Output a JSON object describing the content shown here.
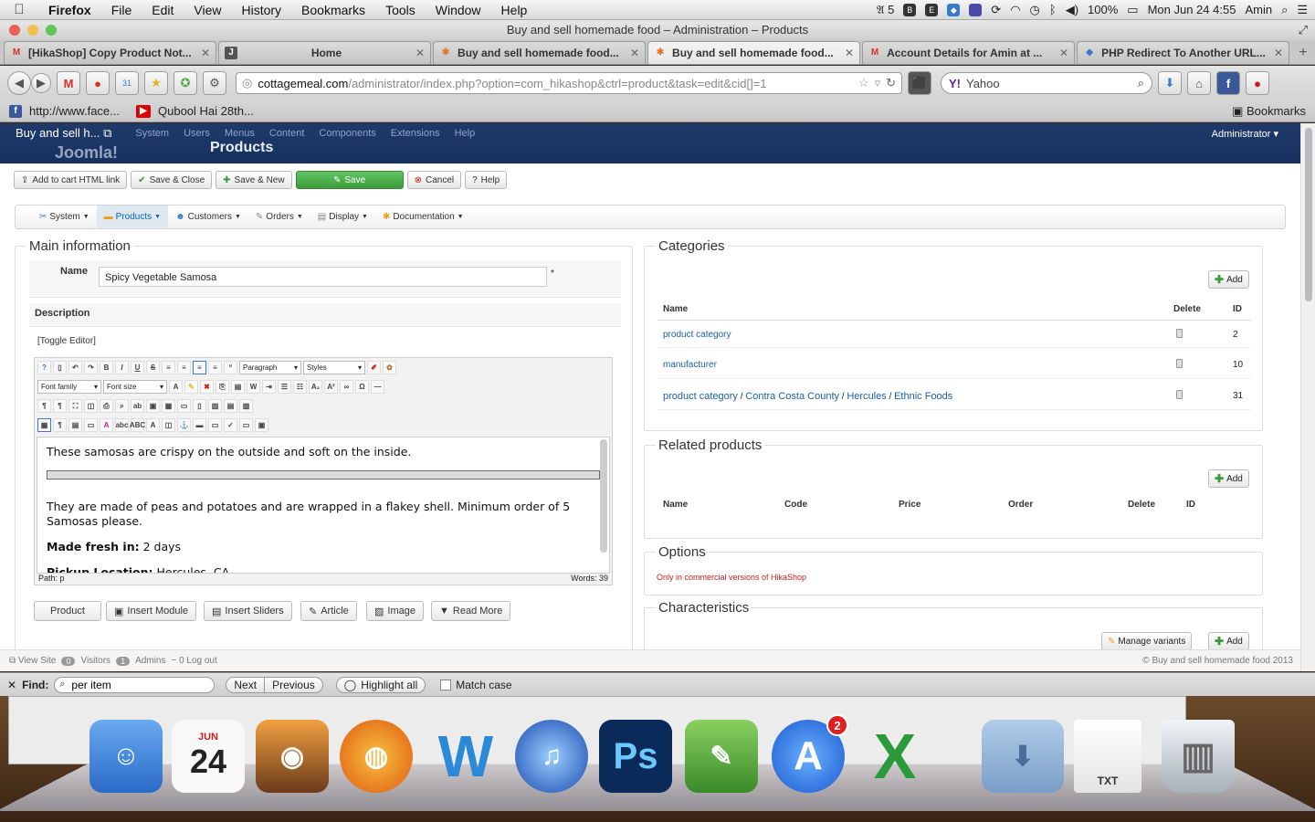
{
  "menubar": {
    "app": "Firefox",
    "items": [
      "File",
      "Edit",
      "View",
      "History",
      "Bookmarks",
      "Tools",
      "Window",
      "Help"
    ],
    "battery": "100%",
    "datetime": "Mon Jun 24  4:55",
    "user": "Amin",
    "badge": "5"
  },
  "window": {
    "title": "Buy and sell homemade food – Administration – Products"
  },
  "tabs": [
    {
      "title": "[HikaShop] Copy Product Not...",
      "icon": "gmail-icon",
      "color": "#d93025",
      "glyph": "M"
    },
    {
      "title": "",
      "icon": "joomla-icon",
      "color": "#555",
      "glyph": "J"
    },
    {
      "title": "Home",
      "icon": "",
      "color": "",
      "glyph": ""
    },
    {
      "title": "Buy and sell homemade food...",
      "icon": "joomla-icon",
      "color": "#e8742a",
      "glyph": "✱"
    },
    {
      "title": "Buy and sell homemade food...",
      "icon": "joomla-icon",
      "color": "#e8742a",
      "glyph": "✱"
    },
    {
      "title": "Account Details for Amin at ...",
      "icon": "gmail-icon",
      "color": "#d93025",
      "glyph": "M"
    },
    {
      "title": "PHP Redirect To Another URL...",
      "icon": "web-icon",
      "color": "#3a7ac8",
      "glyph": "◆"
    }
  ],
  "url": {
    "host": "cottagemeal.com",
    "path": "/administrator/index.php?option=com_hikashop&ctrl=product&task=edit&cid[]=1"
  },
  "search": {
    "engine": "Yahoo"
  },
  "bookmarks": {
    "items": [
      "http://www.face...",
      "Qubool Hai 28th..."
    ],
    "right": "Bookmarks"
  },
  "joomla": {
    "site": "Buy and sell h...",
    "nav": [
      "System",
      "Users",
      "Menus",
      "Content",
      "Components",
      "Extensions",
      "Help"
    ],
    "admin": "Administrator",
    "logo": "Joomla!",
    "page_title": "Products"
  },
  "toolbar": {
    "add_cart": "Add to cart HTML link",
    "save_close": "Save & Close",
    "save_new": "Save & New",
    "save": "Save",
    "cancel": "Cancel",
    "help": "Help"
  },
  "hikamenu": [
    "System",
    "Products",
    "Customers",
    "Orders",
    "Display",
    "Documentation"
  ],
  "main": {
    "legend": "Main information",
    "name_label": "Name",
    "name_value": "Spicy Vegetable Samosa",
    "required": "*",
    "desc_label": "Description",
    "toggle": "[Toggle Editor]"
  },
  "editor": {
    "para_select": "Paragraph",
    "styles_select": "Styles",
    "font_family": "Font family",
    "font_size": "Font size",
    "text1": "These samosas are crispy on the outside and soft on the inside.",
    "text2": "They are made of peas and potatoes and are wrapped in a flakey shell. Minimum order of 5 Samosas please.",
    "made_label": "Made fresh in:",
    "made_value": " 2 days",
    "pickup_label": "Pickup Location:",
    "pickup_value": " Hercules, CA",
    "path": "Path:  p",
    "words": "Words: 39"
  },
  "editor_buttons": [
    "Product",
    "Insert Module",
    "Insert Sliders",
    "Article",
    "Image",
    "Read More"
  ],
  "categories": {
    "legend": "Categories",
    "add": "Add",
    "headers": [
      "Name",
      "Delete",
      "ID"
    ],
    "rows": [
      {
        "path": [
          "product category"
        ],
        "id": "2"
      },
      {
        "path": [
          "manufacturer"
        ],
        "id": "10"
      },
      {
        "path": [
          "product category",
          "Contra Costa County",
          "Hercules",
          "Ethnic Foods"
        ],
        "id": "31"
      }
    ]
  },
  "related": {
    "legend": "Related products",
    "add": "Add",
    "headers": [
      "Name",
      "Code",
      "Price",
      "Order",
      "Delete",
      "ID"
    ]
  },
  "options": {
    "legend": "Options",
    "note": "Only in commercial versions of HikaShop"
  },
  "characteristics": {
    "legend": "Characteristics",
    "manage": "Manage variants",
    "add": "Add"
  },
  "status": {
    "view_site": "View Site",
    "visitors_count": "0",
    "visitors": "Visitors",
    "admins_count": "1",
    "admins": "Admins",
    "logout_count": "0",
    "logout": "Log out",
    "copyright": "© Buy and sell homemade food 2013"
  },
  "findbar": {
    "label": "Find:",
    "value": "per item",
    "next": "Next",
    "previous": "Previous",
    "highlight": "Highlight all",
    "match": "Match case"
  },
  "dock": [
    {
      "name": "finder-icon",
      "color": "#4a8ad8",
      "glyph": "☺"
    },
    {
      "name": "calendar-icon",
      "color": "#f4f4f4",
      "glyph": "24",
      "month": "JUN"
    },
    {
      "name": "iphoto-icon",
      "color": "#c87a30",
      "glyph": "◉"
    },
    {
      "name": "firefox-icon",
      "color": "#e86a10",
      "glyph": "◍"
    },
    {
      "name": "word-icon",
      "color": "#2a8ad8",
      "glyph": "W"
    },
    {
      "name": "itunes-icon",
      "color": "#2a6ac8",
      "glyph": "♫"
    },
    {
      "name": "photoshop-icon",
      "color": "#0a3a6a",
      "glyph": "Ps"
    },
    {
      "name": "evernote-icon",
      "color": "#5aa83a",
      "glyph": "✎"
    },
    {
      "name": "appstore-icon",
      "color": "#2a7ae8",
      "glyph": "A",
      "badge": "2"
    },
    {
      "name": "excel-icon",
      "color": "#2a9a3a",
      "glyph": "X"
    },
    {
      "name": "downloads-icon",
      "color": "#8aaed8",
      "glyph": "⬇"
    },
    {
      "name": "txt-icon",
      "color": "#f0f0f0",
      "glyph": "TXT"
    },
    {
      "name": "trash-icon",
      "color": "#cfd4d8",
      "glyph": "🗑"
    }
  ]
}
